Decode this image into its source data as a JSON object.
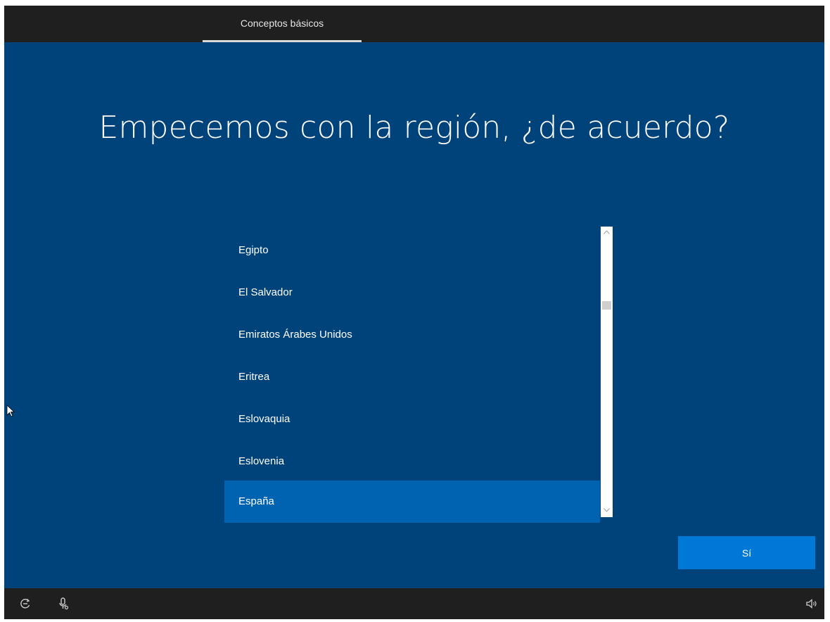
{
  "header": {
    "step_label": "Conceptos básicos"
  },
  "main": {
    "heading": "Empecemos con la región, ¿de acuerdo?",
    "region_list": {
      "items": [
        "Egipto",
        "El Salvador",
        "Emiratos Árabes Unidos",
        "Eritrea",
        "Eslovaquia",
        "Eslovenia",
        "España"
      ],
      "selected": "España"
    },
    "confirm_button_label": "Sí"
  },
  "footer": {
    "icons": [
      "ease-of-access-icon",
      "microphone-icon",
      "volume-icon"
    ]
  },
  "colors": {
    "background": "#00427a",
    "selection": "#0063b1",
    "button": "#0078d7",
    "bars": "#1f1f1f"
  }
}
